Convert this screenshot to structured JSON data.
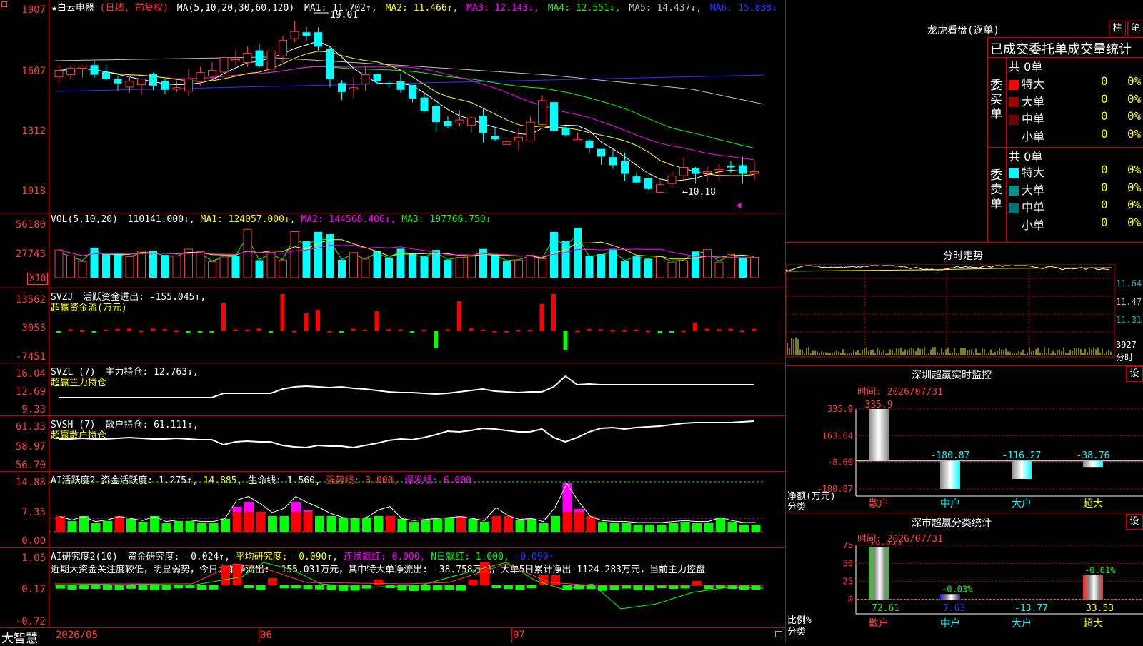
{
  "app": {
    "brand": "大智慧"
  },
  "main": {
    "stock_title": "★白云电器",
    "period_label": "(日线, 前复权)",
    "ma_header": "MA(5,10,20,30,60,120)",
    "ma": [
      {
        "text": "MA1: 11.702↑,",
        "color": "#ffffff"
      },
      {
        "text": "MA2: 11.466↑,",
        "color": "#ffff00"
      },
      {
        "text": "MA3: 12.143↓,",
        "color": "#ff00ff"
      },
      {
        "text": "MA4: 12.551↓,",
        "color": "#00ff00"
      },
      {
        "text": "MA5: 14.437↓,",
        "color": "#c0c0c0"
      },
      {
        "text": "MA6: 15.838↓",
        "color": "#3030ff"
      }
    ],
    "y_ticks": [
      "1907",
      "1607",
      "1312",
      "1018"
    ],
    "high_label": "19.01",
    "low_label": "←10.18"
  },
  "vol": {
    "header": "VOL(5,10,20)",
    "value": "110141.000↓,",
    "ma": [
      {
        "text": "MA1: 124057.000↓,",
        "color": "#ffff00"
      },
      {
        "text": "MA2: 144568.406↓,",
        "color": "#ff00ff"
      },
      {
        "text": "MA3: 197766.750↓",
        "color": "#00ff00"
      }
    ],
    "y_ticks": [
      "56180",
      "27743"
    ],
    "unit": "X10"
  },
  "svzj": {
    "header": "SVZJ",
    "label": "活跃资金进出: -155.045↑,",
    "subtitle": "超赢资金流(万元)",
    "y_ticks": [
      "13562",
      "3055",
      "-7451"
    ]
  },
  "svzl": {
    "header": "SVZL (7)",
    "label": "主力持仓: 12.763↓,",
    "subtitle": "超赢主力持仓",
    "y_ticks": [
      "16.04",
      "12.69",
      "9.33"
    ]
  },
  "svsh": {
    "header": "SVSH (7)",
    "label": "散户持仓: 61.111↑,",
    "subtitle": "超赢散户持仓",
    "y_ticks": [
      "61.33",
      "58.97",
      "56.70"
    ]
  },
  "ai1": {
    "header": "AI活跃度2",
    "parts": [
      {
        "text": "资金活跃度: 1.275↑,",
        "color": "#ffffff"
      },
      {
        "text": "14.885,",
        "color": "#ffff00"
      },
      {
        "text": "生命线: 1.560,",
        "color": "#ffffff"
      },
      {
        "text": "强势线: 3.000,",
        "color": "#ff3c3c"
      },
      {
        "text": "爆发线: 6.000,",
        "color": "#ff00ff"
      }
    ],
    "y_ticks": [
      "14.88",
      "7.35",
      "0.00"
    ]
  },
  "ai2": {
    "header": "AI研究度2(10)",
    "parts": [
      {
        "text": "资金研究度: -0.024↑,",
        "color": "#ffffff"
      },
      {
        "text": "平均研究度: -0.090↑,",
        "color": "#ffff00"
      },
      {
        "text": "连续飘红: 0.000,",
        "color": "#ff00ff"
      },
      {
        "text": "N日飘红: 1.000,",
        "color": "#00ff00"
      },
      {
        "text": "-0.090↑",
        "color": "#3030ff"
      }
    ],
    "note": "近期大资金关注度较低，明显弱势，今日大单净流出: -155.031万元，其中特大单净流出: -38.758万元，大单5日累计净出-1124.283万元，当前主力控盘",
    "y_ticks": [
      "1.05",
      "0.17",
      "-0.72"
    ]
  },
  "xaxis": {
    "labels": [
      "2026/05",
      "06",
      "07"
    ]
  },
  "lhb": {
    "title": "龙虎看盘(逐单)",
    "btn_zhu": "柱",
    "btn_bi": "笔",
    "subtitle": "已成交委托单成交量统计",
    "buy": {
      "side_label": "委买单",
      "total": "共 0单",
      "rows": [
        {
          "label": "特大",
          "count": "0",
          "pct": "0%",
          "color": "#ff0000"
        },
        {
          "label": "大单",
          "count": "0",
          "pct": "0%",
          "color": "#a00000"
        },
        {
          "label": "中单",
          "count": "0",
          "pct": "0%",
          "color": "#700000"
        },
        {
          "label": "小单",
          "count": "0",
          "pct": "0%",
          "color": "#000000"
        }
      ]
    },
    "sell": {
      "side_label": "委卖单",
      "total": "共 0单",
      "rows": [
        {
          "label": "特大",
          "count": "0",
          "pct": "0%",
          "color": "#00ffff"
        },
        {
          "label": "大单",
          "count": "0",
          "pct": "0%",
          "color": "#009090"
        },
        {
          "label": "中单",
          "count": "0",
          "pct": "0%",
          "color": "#007070"
        },
        {
          "label": "小单",
          "count": "0",
          "pct": "0%",
          "color": "#000000"
        }
      ]
    }
  },
  "intraday": {
    "title": "分时走势",
    "y_ticks": [
      "11.64",
      "11.47",
      "11.31"
    ],
    "vol_label": "3927",
    "unit": "分时"
  },
  "monitor": {
    "title": "深圳超赢实时监控",
    "btn": "设",
    "time": "时间: 2026/07/31",
    "y_ticks": [
      "335.9",
      "163.64",
      "-8.60",
      "-180.87"
    ],
    "y_title": "净额(万元)",
    "x_title": "分类",
    "bars": [
      {
        "label": "散户",
        "value": 335.9,
        "value_label": "335.9"
      },
      {
        "label": "中户",
        "value": -180.87,
        "value_label": "-180.87"
      },
      {
        "label": "大户",
        "value": -116.27,
        "value_label": "-116.27"
      },
      {
        "label": "超大",
        "value": -38.76,
        "value_label": "-38.76"
      }
    ]
  },
  "classify": {
    "title": "深市超赢分类统计",
    "btn": "设",
    "time": "时间: 2026/07/31",
    "y_ticks": [
      "75",
      "50",
      "25",
      "0"
    ],
    "y_title": "比例%",
    "x_title": "分类",
    "bars": [
      {
        "label": "散户",
        "value": 72.61,
        "top_label": "+0.05%",
        "bottom_label": "72.61"
      },
      {
        "label": "中户",
        "value": 7.63,
        "top_label": "-0.03%",
        "bottom_label": "7.63"
      },
      {
        "label": "大户",
        "value": -13.77,
        "top_label": "",
        "bottom_label": "-13.77"
      },
      {
        "label": "超大",
        "value": 33.53,
        "top_label": "-0.01%",
        "bottom_label": "33.53"
      }
    ]
  }
}
